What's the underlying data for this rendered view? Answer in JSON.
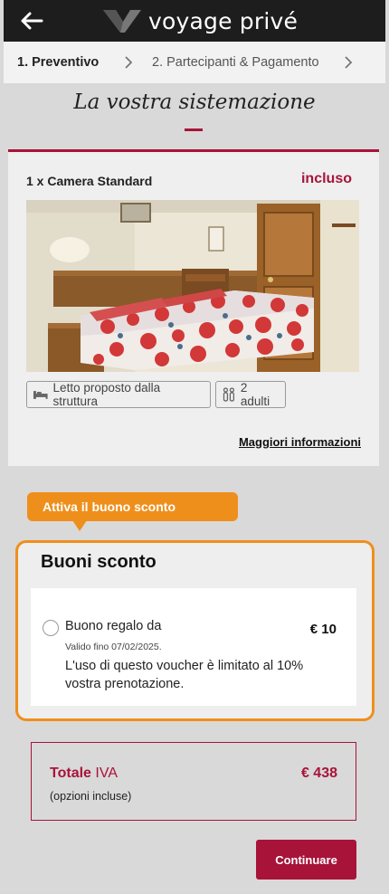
{
  "header": {
    "brand_name": "voyage privé",
    "back_icon": "arrow-left-icon"
  },
  "steps": {
    "step1": "1. Preventivo",
    "step2": "2. Partecipanti & Pagamento"
  },
  "section": {
    "title": "La vostra sistemazione"
  },
  "room": {
    "name": "1 x Camera Standard",
    "price": "incluso",
    "bed_label": "Letto proposto dalla struttura",
    "adults_label": "2 adulti",
    "more_info": "Maggiori informazioni"
  },
  "voucher": {
    "callout": "Attiva il buono sconto",
    "title": "Buoni sconto",
    "item_label": "Buono regalo da",
    "item_amount": "€ 10",
    "item_validity": "Valido fino 07/02/2025.",
    "item_desc_line1": "L'uso di questo voucher è limitato al 10%",
    "item_desc_line2": "vostra prenotazione."
  },
  "total": {
    "label_bold": "Totale",
    "label_rest": "IVA",
    "value": "€ 438",
    "sub": "(opzioni incluse)"
  },
  "actions": {
    "continue_label": "Continuare"
  },
  "colors": {
    "brand": "#a8133a",
    "accent_orange": "#ef8f1b",
    "header_bg": "#1d1d1d"
  }
}
